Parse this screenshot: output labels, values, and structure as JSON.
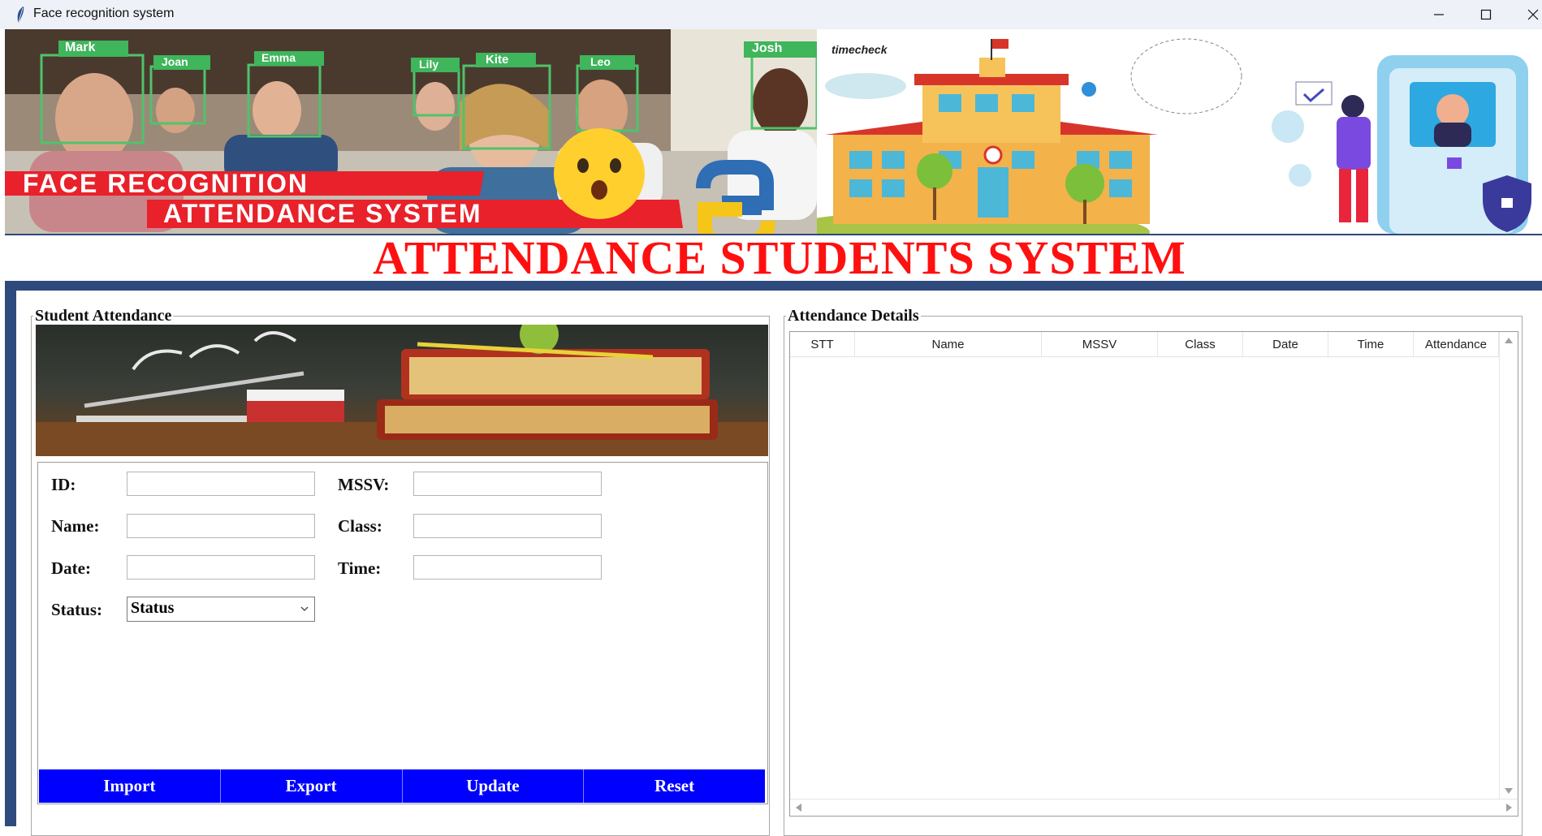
{
  "window": {
    "title": "Face recognition system",
    "minimize_symbol": "—",
    "maximize_symbol": "☐",
    "close_symbol": "✕",
    "app_icon": "feather-icon"
  },
  "banner": {
    "face_labels": [
      "Mark",
      "Joan",
      "Emma",
      "Lily",
      "Kite",
      "Leo",
      "Josh"
    ],
    "line1": "FACE RECOGNITION",
    "line2": "ATTENDANCE SYSTEM",
    "brand": "timecheck"
  },
  "main_title": "ATTENDANCE STUDENTS SYSTEM",
  "colors": {
    "title_red": "#ff1010",
    "button_blue": "#0000ff",
    "frame_navy": "#2f4a7c"
  },
  "student_attendance": {
    "legend": "Student Attendance",
    "fields": {
      "id_label": "ID:",
      "mssv_label": "MSSV:",
      "name_label": "Name:",
      "class_label": "Class:",
      "date_label": "Date:",
      "time_label": "Time:",
      "status_label": "Status:"
    },
    "values": {
      "id": "",
      "mssv": "",
      "name": "",
      "class": "",
      "date": "",
      "time": ""
    },
    "status_selected": "Status",
    "buttons": {
      "import": "Import",
      "export": "Export",
      "update": "Update",
      "reset": "Reset"
    }
  },
  "attendance_details": {
    "legend": "Attendance Details",
    "columns": [
      "STT",
      "Name",
      "MSSV",
      "Class",
      "Date",
      "Time",
      "Attendance"
    ],
    "rows": []
  }
}
